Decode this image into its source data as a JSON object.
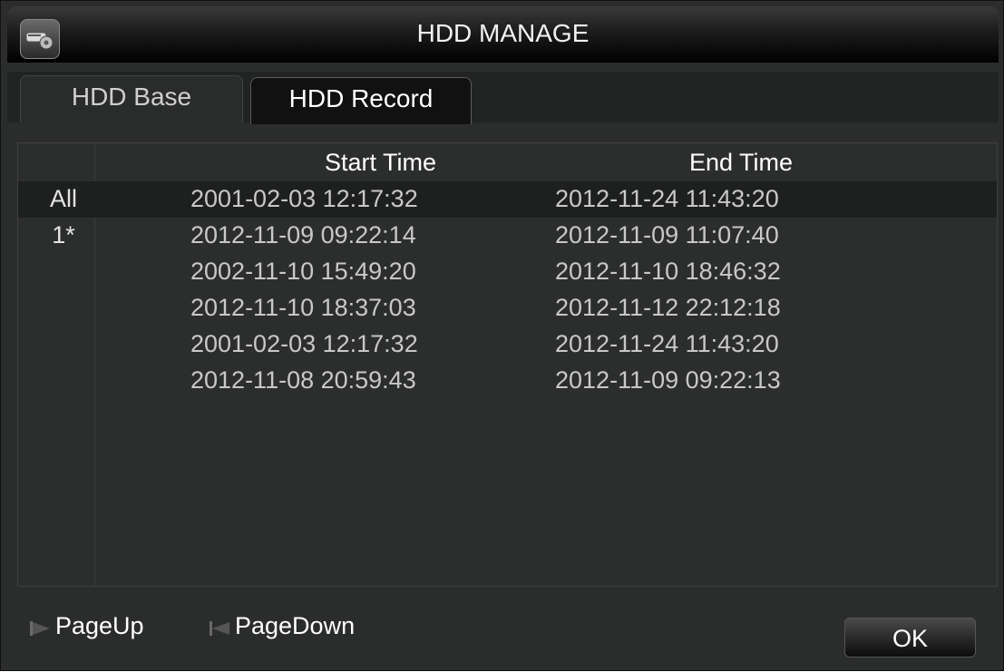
{
  "window": {
    "title": "HDD MANAGE",
    "icon": "hdd-tools-icon"
  },
  "tabs": [
    {
      "label": "HDD Base",
      "active": false
    },
    {
      "label": "HDD Record",
      "active": true
    }
  ],
  "table": {
    "headers": {
      "channel": "",
      "start": "Start Time",
      "end": "End Time"
    },
    "rows": [
      {
        "channel": "All",
        "start": "2001-02-03 12:17:32",
        "end": "2012-11-24 11:43:20"
      },
      {
        "channel": "1*",
        "start": "2012-11-09 09:22:14",
        "end": "2012-11-09 11:07:40"
      },
      {
        "channel": "",
        "start": "2002-11-10 15:49:20",
        "end": "2012-11-10 18:46:32"
      },
      {
        "channel": "",
        "start": "2012-11-10 18:37:03",
        "end": "2012-11-12 22:12:18"
      },
      {
        "channel": "",
        "start": "2001-02-03 12:17:32",
        "end": "2012-11-24 11:43:20"
      },
      {
        "channel": "",
        "start": "2012-11-08 20:59:43",
        "end": "2012-11-09 09:22:13"
      }
    ]
  },
  "footer": {
    "page_up": "PageUp",
    "page_down": "PageDown",
    "ok": "OK"
  }
}
